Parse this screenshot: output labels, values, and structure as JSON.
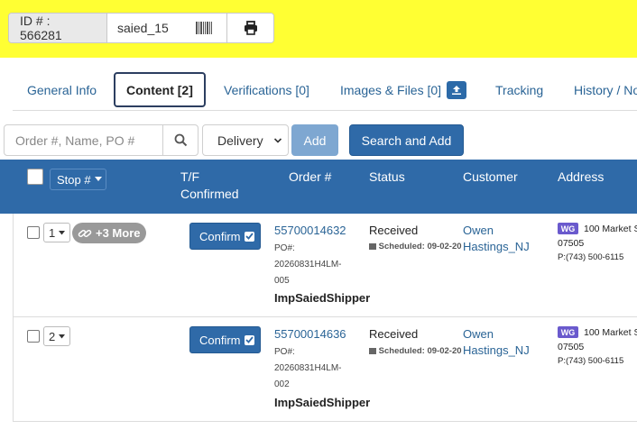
{
  "topbar": {
    "id_label": "ID # : 566281",
    "id_value": "saied_15",
    "barcode_icon": "barcode-icon",
    "print_icon": "printer-icon",
    "background": "#ffff33"
  },
  "tabs": [
    {
      "label": "General Info",
      "active": false
    },
    {
      "label": "Content [2]",
      "active": true
    },
    {
      "label": "Verifications [0]",
      "active": false
    },
    {
      "label": "Images & Files [0]",
      "active": false,
      "icon": "upload-icon"
    },
    {
      "label": "Tracking",
      "active": false
    },
    {
      "label": "History / No",
      "active": false
    }
  ],
  "search": {
    "placeholder": "Order #, Name, PO #",
    "select_value": "Delivery",
    "add_label": "Add",
    "search_add_label": "Search and Add"
  },
  "table": {
    "header_color": "#2f6aa8",
    "columns": {
      "stop": "Stop #",
      "tf_line1": "T/F",
      "tf_line2": "Confirmed",
      "order": "Order #",
      "status": "Status",
      "customer": "Customer",
      "address": "Address"
    },
    "rows": [
      {
        "stop": "1",
        "more": "+3 More",
        "confirm": "Confirm",
        "order": "55700014632",
        "po_label": "PO#:",
        "po_line1": "20260831H4LM-",
        "po_line2": "005",
        "shipper": "ImpSaiedShipper",
        "status": "Received",
        "scheduled": "Scheduled: 09-02-20",
        "customer_line1": "Owen",
        "customer_line2": "Hastings_NJ",
        "badge": "WG",
        "address_line1": "100 Market S",
        "address_line2": "07505",
        "phone": "P:(743) 500-6115"
      },
      {
        "stop": "2",
        "confirm": "Confirm",
        "order": "55700014636",
        "po_label": "PO#:",
        "po_line1": "20260831H4LM-",
        "po_line2": "002",
        "shipper": "ImpSaiedShipper",
        "status": "Received",
        "scheduled": "Scheduled: 09-02-20",
        "customer_line1": "Owen",
        "customer_line2": "Hastings_NJ",
        "badge": "WG",
        "address_line1": "100 Market S",
        "address_line2": "07505",
        "phone": "P:(743) 500-6115"
      }
    ]
  }
}
